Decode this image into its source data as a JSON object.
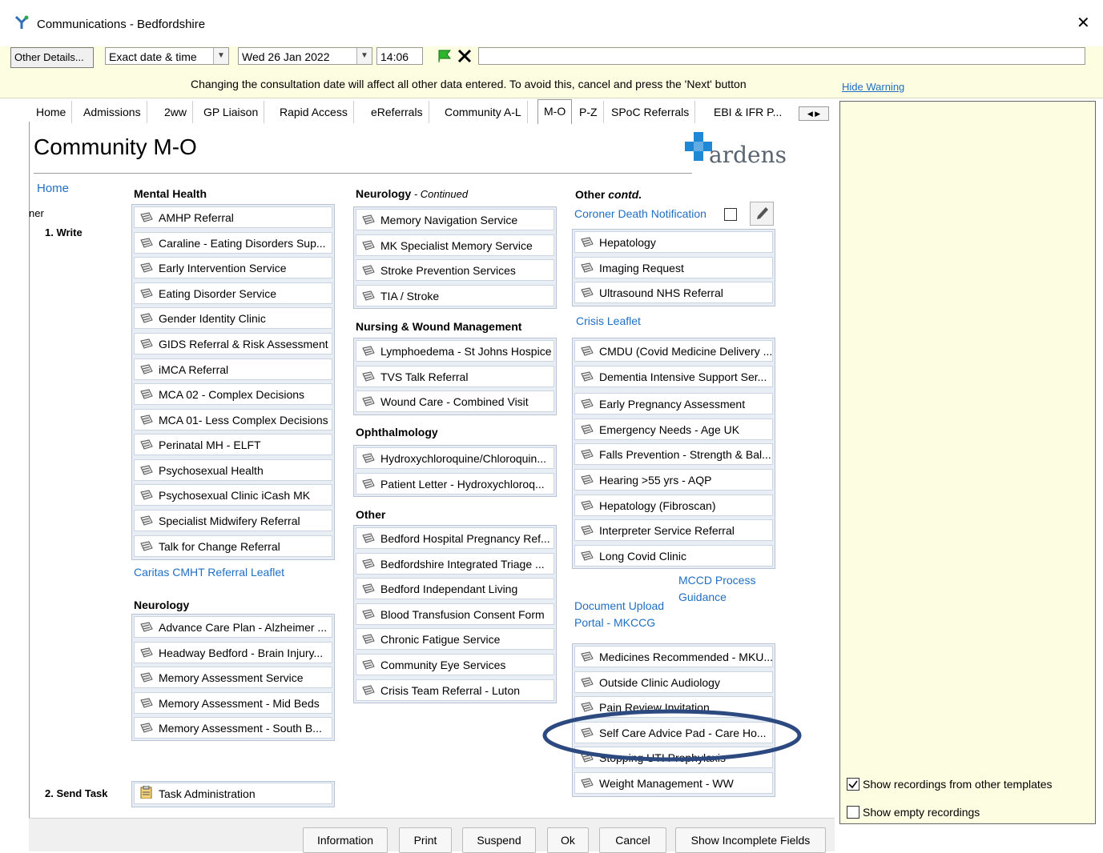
{
  "window": {
    "title": "Communications - Bedfordshire",
    "close": "✕"
  },
  "toolbar": {
    "other_details": "Other Details...",
    "date_mode": "Exact date & time",
    "date": "Wed 26 Jan 2022",
    "time": "14:06",
    "note_value": ""
  },
  "warning": {
    "text": "Changing the consultation date will affect all other data entered. To avoid this, cancel and press the 'Next' button",
    "hide": "Hide Warning"
  },
  "tabs": [
    "Home",
    "Admissions",
    "2ww",
    "GP Liaison",
    "Rapid Access",
    "eReferrals",
    "Community A-L",
    "M-O",
    "P-Z",
    "SPoC Referrals",
    "EBI & IFR P..."
  ],
  "page": {
    "title": "Community M-O",
    "logo_text": "ardens"
  },
  "side": {
    "home": "Home",
    "partial": "ner",
    "write": "1. Write",
    "send_task": "2. Send Task"
  },
  "col1": {
    "mental_health": "Mental Health",
    "mh_items": [
      "AMHP Referral",
      "Caraline - Eating Disorders Sup...",
      "Early Intervention Service",
      "Eating Disorder Service",
      "Gender Identity Clinic",
      "GIDS Referral & Risk Assessment",
      "iMCA Referral",
      "MCA 02 - Complex Decisions",
      "MCA 01- Less Complex Decisions",
      "Perinatal MH - ELFT",
      "Psychosexual Health",
      "Psychosexual Clinic iCash MK",
      "Specialist Midwifery Referral",
      "Talk for Change Referral"
    ],
    "caritas_link": "Caritas CMHT Referral Leaflet",
    "neurology": "Neurology",
    "neuro_items": [
      "Advance Care Plan - Alzheimer ...",
      "Headway Bedford - Brain Injury...",
      "Memory Assessment Service",
      "Memory Assessment - Mid Beds",
      "Memory Assessment - South B..."
    ],
    "task_item": "Task Administration"
  },
  "col2": {
    "neuro_cont": "Neurology",
    "neuro_cont_suffix": " - Continued",
    "neuro_items": [
      "Memory Navigation Service",
      "MK Specialist Memory Service",
      "Stroke Prevention Services",
      "TIA / Stroke"
    ],
    "nursing": "Nursing & Wound Management",
    "nursing_items": [
      "Lymphoedema - St Johns Hospice",
      "TVS Talk Referral",
      "Wound Care - Combined Visit"
    ],
    "ophth": "Ophthalmology",
    "ophth_items": [
      "Hydroxychloroquine/Chloroquin...",
      "Patient Letter - Hydroxychloroq..."
    ],
    "other": "Other",
    "other_items": [
      "Bedford Hospital Pregnancy Ref...",
      "Bedfordshire Integrated Triage ...",
      "Bedford Independant Living",
      "Blood Transfusion Consent Form",
      "Chronic Fatigue Service",
      "Community Eye Services",
      "Crisis Team Referral - Luton"
    ]
  },
  "col3": {
    "other_contd": "Other ",
    "other_contd_em": "contd.",
    "coroner_link": "Coroner Death Notification",
    "items_a": [
      "Hepatology",
      "Imaging Request",
      "Ultrasound NHS Referral"
    ],
    "crisis_link": "Crisis Leaflet",
    "items_b": [
      "CMDU (Covid Medicine Delivery ...",
      "Dementia Intensive Support Ser...",
      "Early Pregnancy Assessment",
      "Emergency Needs - Age UK",
      "Falls Prevention - Strength & Bal...",
      "Hearing >55 yrs - AQP",
      "Hepatology (Fibroscan)",
      "Interpreter Service Referral",
      "Long Covid Clinic"
    ],
    "mccd_link_1": "MCCD Process",
    "mccd_link_2": "Guidance",
    "doc_link_1": "Document Upload",
    "doc_link_2": "Portal - MKCCG",
    "items_c": [
      "Medicines Recommended - MKU...",
      "Outside Clinic Audiology",
      "Pain Review Invitation",
      "Self Care Advice Pad - Care Ho...",
      "Stopping UTI Prophylaxis",
      "Weight Management - WW"
    ]
  },
  "right_panel": {
    "opt1": "Show recordings from other templates",
    "opt1_checked": true,
    "opt2": "Show empty recordings",
    "opt2_checked": false
  },
  "buttons": [
    "Information",
    "Print",
    "Suspend",
    "Ok",
    "Cancel",
    "Show Incomplete Fields"
  ],
  "colors": {
    "link": "#1f6fc4",
    "ribbon": "#fdfde2",
    "highlight_ellipse": "#2d4a80",
    "logo_blue": "#1e88d6"
  }
}
